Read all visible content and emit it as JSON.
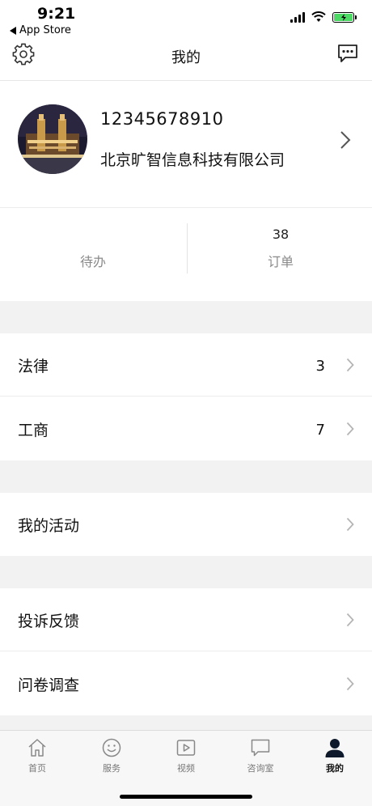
{
  "status_bar": {
    "time": "9:21",
    "back_app": "App Store"
  },
  "nav": {
    "title": "我的",
    "left_icon": "settings-gear-icon",
    "right_icon": "message-icon"
  },
  "profile": {
    "phone": "12345678910",
    "company": "北京旷智信息科技有限公司"
  },
  "stats": [
    {
      "label": "待办",
      "count": ""
    },
    {
      "label": "订单",
      "count": "38"
    }
  ],
  "menu": {
    "law": {
      "label": "法律",
      "count": "3"
    },
    "business": {
      "label": "工商",
      "count": "7"
    },
    "activities": {
      "label": "我的活动"
    },
    "complaint": {
      "label": "投诉反馈"
    },
    "survey": {
      "label": "问卷调查"
    }
  },
  "tabs": [
    {
      "label": "首页",
      "icon": "home-icon"
    },
    {
      "label": "服务",
      "icon": "smile-icon"
    },
    {
      "label": "视频",
      "icon": "video-play-icon"
    },
    {
      "label": "咨询室",
      "icon": "chat-icon"
    },
    {
      "label": "我的",
      "icon": "user-icon",
      "active": true
    }
  ],
  "colors": {
    "background": "#ffffff",
    "section_gap": "#f2f2f2",
    "muted_text": "#8a8a8a",
    "battery": "#4cd964"
  }
}
